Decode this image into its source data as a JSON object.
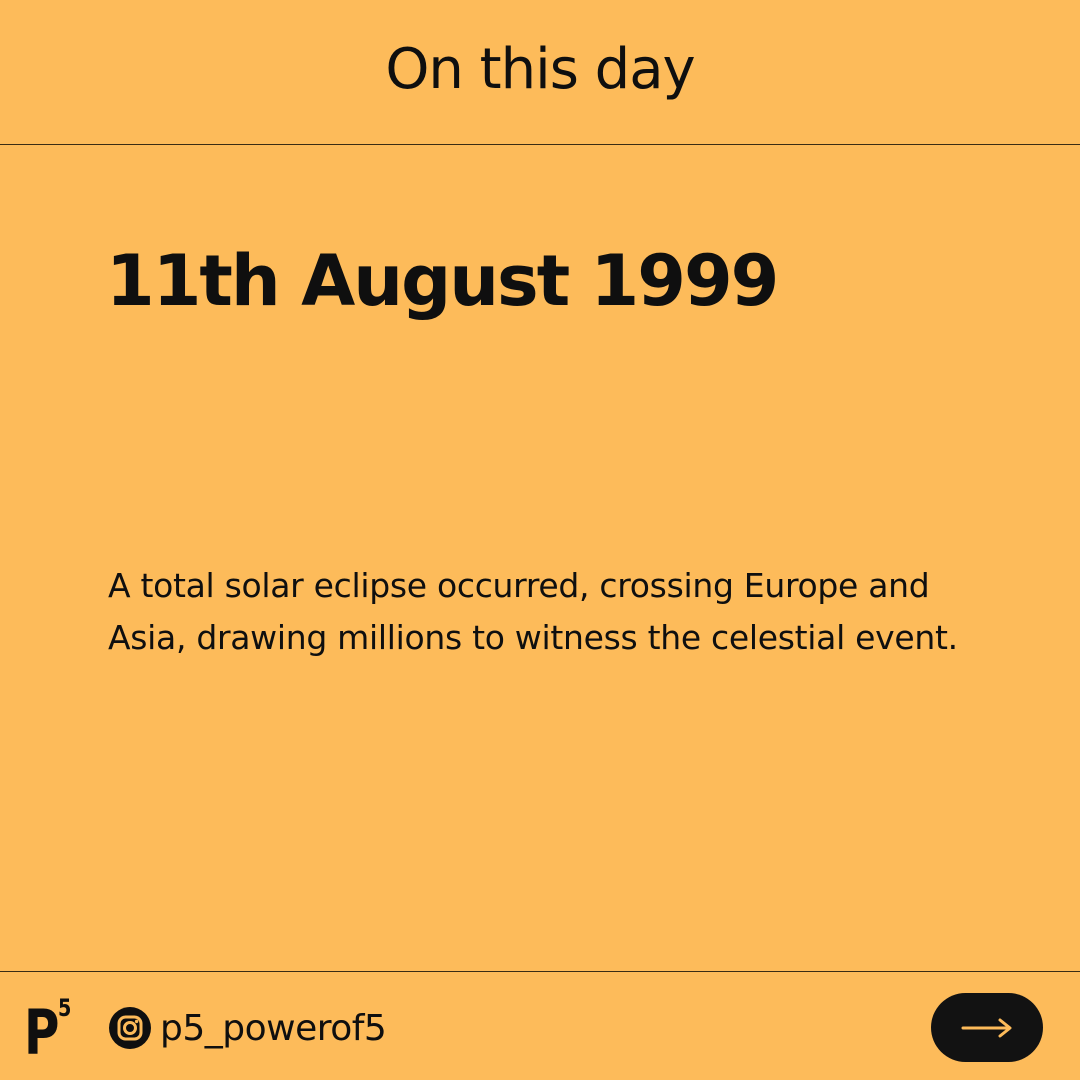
{
  "header": {
    "title": "On this day"
  },
  "event": {
    "date": "11th August 1999",
    "description": "A total solar eclipse occurred, crossing Europe and Asia, drawing millions to witness the celestial event."
  },
  "footer": {
    "logo": {
      "letter": "P",
      "superscript": "5"
    },
    "handle": {
      "icon": "instagram-icon",
      "text": "p5_powerof5"
    },
    "next_button": {
      "icon": "arrow-right-icon"
    }
  },
  "colors": {
    "background": "#FDBB5A",
    "text": "#0F0F0F",
    "button": "#121212",
    "button_icon": "#FDBB5A"
  }
}
